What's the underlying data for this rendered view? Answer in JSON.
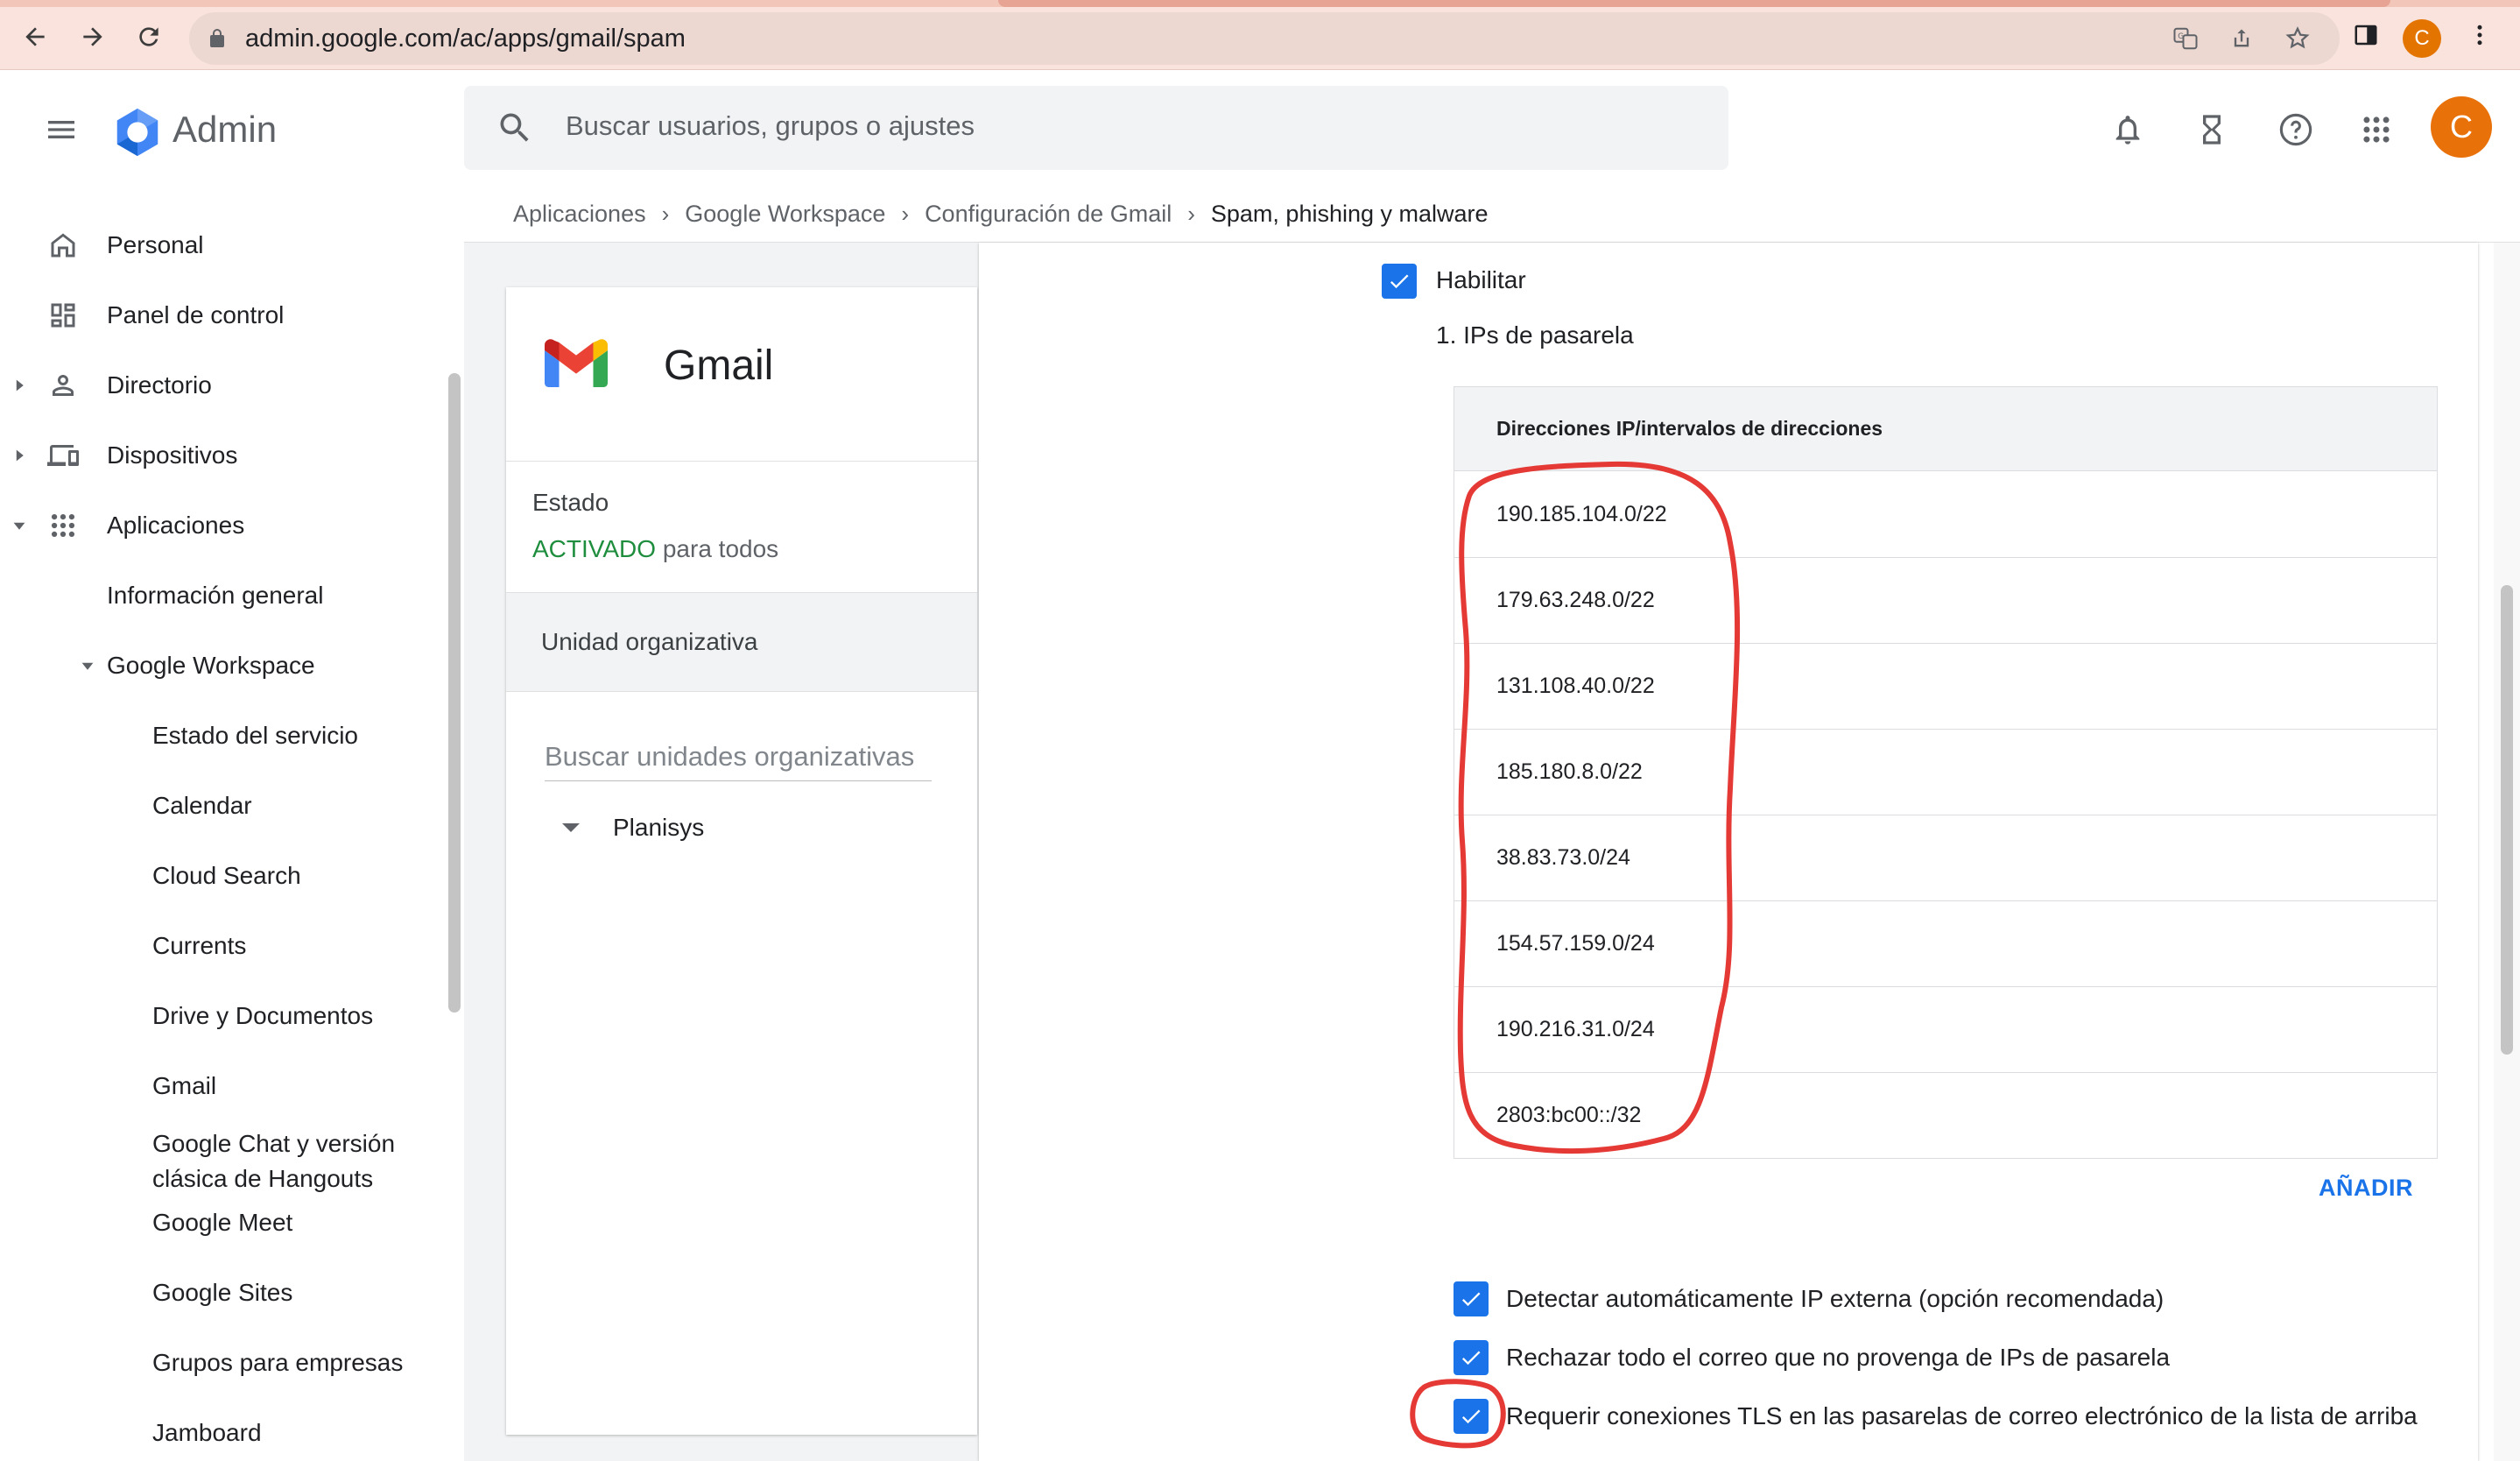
{
  "browser": {
    "url": "admin.google.com/ac/apps/gmail/spam",
    "profile_initial": "C"
  },
  "header": {
    "app_name": "Admin",
    "search_placeholder": "Buscar usuarios, grupos o ajustes",
    "avatar_initial": "C"
  },
  "sidebar": {
    "items": [
      {
        "label": "Personal",
        "icon": "home-icon"
      },
      {
        "label": "Panel de control",
        "icon": "dashboard-icon"
      },
      {
        "label": "Directorio",
        "icon": "person-icon"
      },
      {
        "label": "Dispositivos",
        "icon": "devices-icon"
      },
      {
        "label": "Aplicaciones",
        "icon": "apps-grid-icon"
      },
      {
        "label": "Información general"
      },
      {
        "label": "Google Workspace"
      },
      {
        "label": "Estado del servicio"
      },
      {
        "label": "Calendar"
      },
      {
        "label": "Cloud Search"
      },
      {
        "label": "Currents"
      },
      {
        "label": "Drive y Documentos"
      },
      {
        "label": "Gmail"
      },
      {
        "label": "Google Chat y versión"
      },
      {
        "label": "clásica de Hangouts"
      },
      {
        "label": "Google Meet"
      },
      {
        "label": "Google Sites"
      },
      {
        "label": "Grupos para empresas"
      },
      {
        "label": "Jamboard"
      }
    ]
  },
  "breadcrumb": [
    "Aplicaciones",
    "Google Workspace",
    "Configuración de Gmail",
    "Spam, phishing y malware"
  ],
  "app_card": {
    "title": "Gmail",
    "status_label": "Estado",
    "status_value": "ACTIVADO",
    "status_suffix": "para todos",
    "org_unit_header": "Unidad organizativa",
    "org_search_placeholder": "Buscar unidades organizativas",
    "org_root": "Planisys"
  },
  "settings": {
    "enable_label": "Habilitar",
    "section_title": "1. IPs de pasarela",
    "table_header": "Direcciones IP/intervalos de direcciones",
    "ip_ranges": [
      "190.185.104.0/22",
      "179.63.248.0/22",
      "131.108.40.0/22",
      "185.180.8.0/22",
      "38.83.73.0/24",
      "154.57.159.0/24",
      "190.216.31.0/24",
      "2803:bc00::/32"
    ],
    "add_button": "AÑADIR",
    "options": [
      {
        "label": "Detectar automáticamente IP externa (opción recomendada)",
        "checked": true
      },
      {
        "label": "Rechazar todo el correo que no provenga de IPs de pasarela",
        "checked": true
      },
      {
        "label": "Requerir conexiones TLS en las pasarelas de correo electrónico de la lista de arriba",
        "checked": true
      }
    ]
  },
  "colors": {
    "accent": "#1a73e8",
    "status_on": "#1e8e3e",
    "annotation": "#e53935"
  }
}
